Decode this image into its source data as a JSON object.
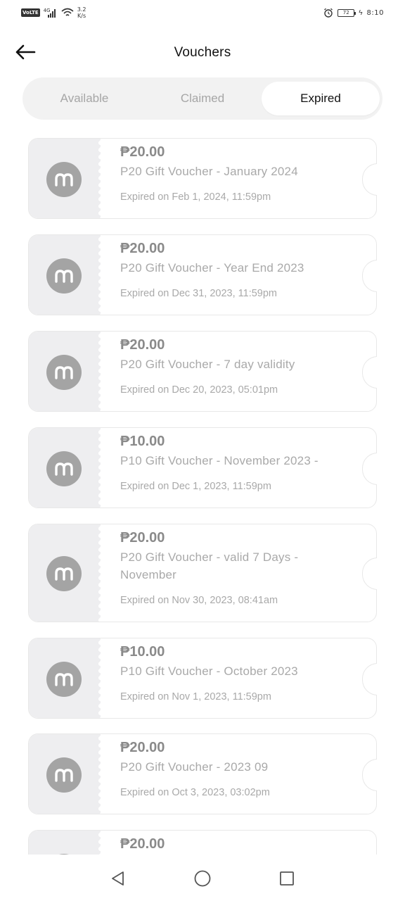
{
  "status_bar": {
    "network_badge": "VoLTE",
    "signal_tag": "4G",
    "speed_value": "3.2",
    "speed_unit": "K/s",
    "battery": "72",
    "time": "8:10"
  },
  "header": {
    "title": "Vouchers",
    "back_icon": "arrow-left-icon"
  },
  "tabs": [
    {
      "label": "Available",
      "active": false
    },
    {
      "label": "Claimed",
      "active": false
    },
    {
      "label": "Expired",
      "active": true
    }
  ],
  "vouchers": [
    {
      "amount": "₱20.00",
      "name": "P20 Gift Voucher - January 2024",
      "expiry": "Expired on Feb 1, 2024, 11:59pm"
    },
    {
      "amount": "₱20.00",
      "name": "P20 Gift Voucher - Year End 2023",
      "expiry": "Expired on Dec 31, 2023, 11:59pm"
    },
    {
      "amount": "₱20.00",
      "name": "P20 Gift Voucher - 7 day validity",
      "expiry": "Expired on Dec 20, 2023, 05:01pm"
    },
    {
      "amount": "₱10.00",
      "name": "P10 Gift Voucher - November 2023 -",
      "expiry": "Expired on Dec 1, 2023, 11:59pm"
    },
    {
      "amount": "₱20.00",
      "name": "P20 Gift Voucher - valid 7 Days - November",
      "expiry": "Expired on Nov 30, 2023, 08:41am"
    },
    {
      "amount": "₱10.00",
      "name": "P10 Gift Voucher - October 2023",
      "expiry": "Expired on Nov 1, 2023, 11:59pm"
    },
    {
      "amount": "₱20.00",
      "name": "P20 Gift Voucher - 2023 09",
      "expiry": "Expired on Oct 3, 2023, 03:02pm"
    },
    {
      "amount": "₱20.00",
      "name": "",
      "expiry": ""
    }
  ],
  "colors": {
    "stub": "#eeeef0",
    "logo": "#a4a4a4",
    "muted_text": "#a9a9a9",
    "amount_text": "#8a8a8a"
  },
  "nav": {
    "back_icon": "triangle-back-icon",
    "home_icon": "circle-home-icon",
    "recents_icon": "square-recents-icon"
  }
}
